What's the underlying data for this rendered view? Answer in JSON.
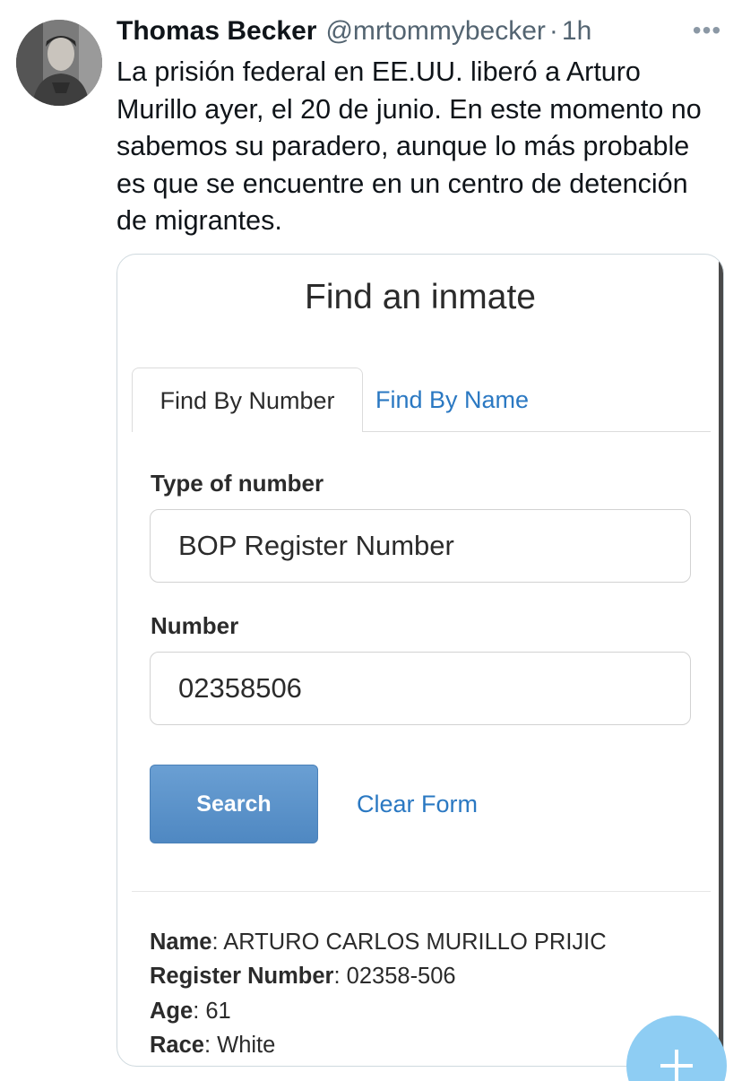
{
  "tweet": {
    "display_name": "Thomas Becker",
    "handle": "@mrtommybecker",
    "separator": "·",
    "time": "1h",
    "more_label": "•••",
    "text": "La prisión federal en EE.UU. liberó a Arturo Murillo ayer, el 20 de junio. En este momento no sabemos su paradero, aunque lo más probable es que se encuentre en un centro de detención de migrantes."
  },
  "inmate_page": {
    "title": "Find an inmate",
    "tabs": [
      {
        "label": "Find By Number",
        "active": true
      },
      {
        "label": "Find By Name",
        "active": false
      }
    ],
    "type_of_number_label": "Type of number",
    "type_of_number_value": "BOP Register Number",
    "number_label": "Number",
    "number_value": "02358506",
    "search_label": "Search",
    "clear_label": "Clear Form",
    "result": {
      "name_label": "Name",
      "name_value": "ARTURO CARLOS MURILLO PRIJIC",
      "register_label": "Register Number",
      "register_value": "02358-506",
      "age_label": "Age",
      "age_value": "61",
      "race_label": "Race",
      "race_value": "White"
    }
  },
  "compose_button": {
    "icon": "plus-icon"
  },
  "colors": {
    "link_blue": "#2a78c2",
    "button_blue": "#5b93c9",
    "fab_blue": "#8ecdf3",
    "muted_gray": "#536471"
  }
}
